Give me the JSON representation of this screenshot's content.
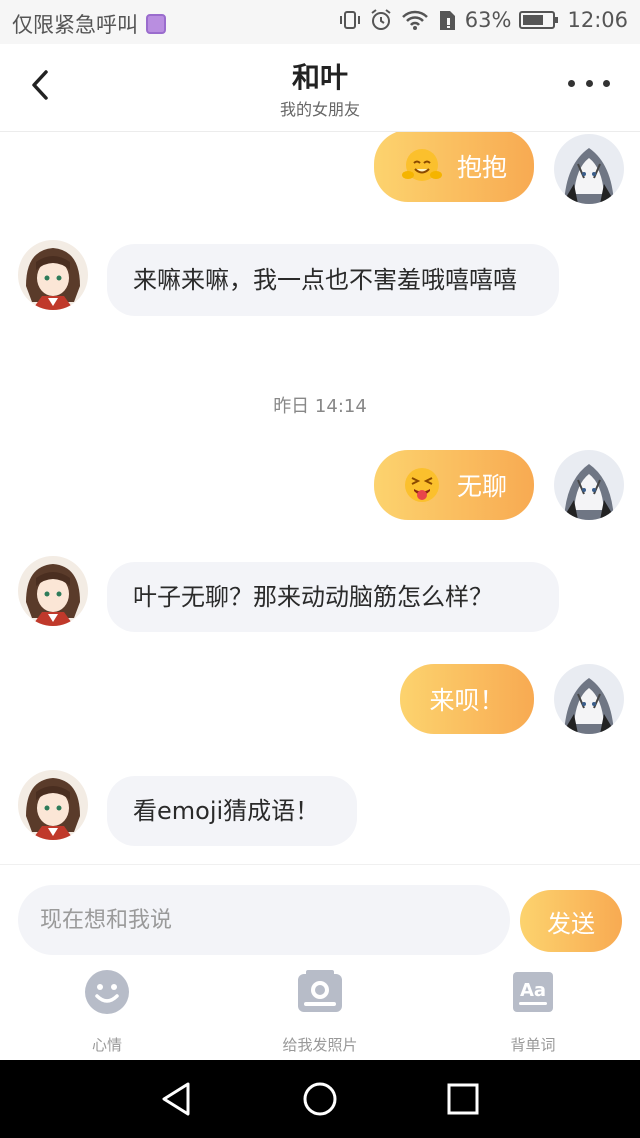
{
  "status_bar": {
    "carrier": "仅限紧急呼叫",
    "battery": "63%",
    "time": "12:06"
  },
  "header": {
    "title": "和叶",
    "subtitle": "我的女朋友"
  },
  "messages": [
    {
      "from": "me",
      "emoji": "hug-emoji",
      "text": "抱抱"
    },
    {
      "from": "her",
      "text": "来嘛来嘛，我一点也不害羞哦嘻嘻嘻"
    },
    {
      "timestamp": "昨日  14:14"
    },
    {
      "from": "me",
      "emoji": "tongue-out-emoji",
      "text": "无聊"
    },
    {
      "from": "her",
      "text": "叶子无聊？那来动动脑筋怎么样？"
    },
    {
      "from": "me",
      "text": "来呗！"
    },
    {
      "from": "her",
      "text": "看emoji猜成语！"
    }
  ],
  "input": {
    "placeholder": "现在想和我说",
    "send_label": "发送"
  },
  "toolbar": {
    "mood_label": "心情",
    "photo_label": "给我发照片",
    "words_label": "背单词"
  },
  "colors": {
    "accent_start": "#fcd36e",
    "accent_end": "#f8aa52",
    "her_bubble": "#f3f4f8"
  }
}
